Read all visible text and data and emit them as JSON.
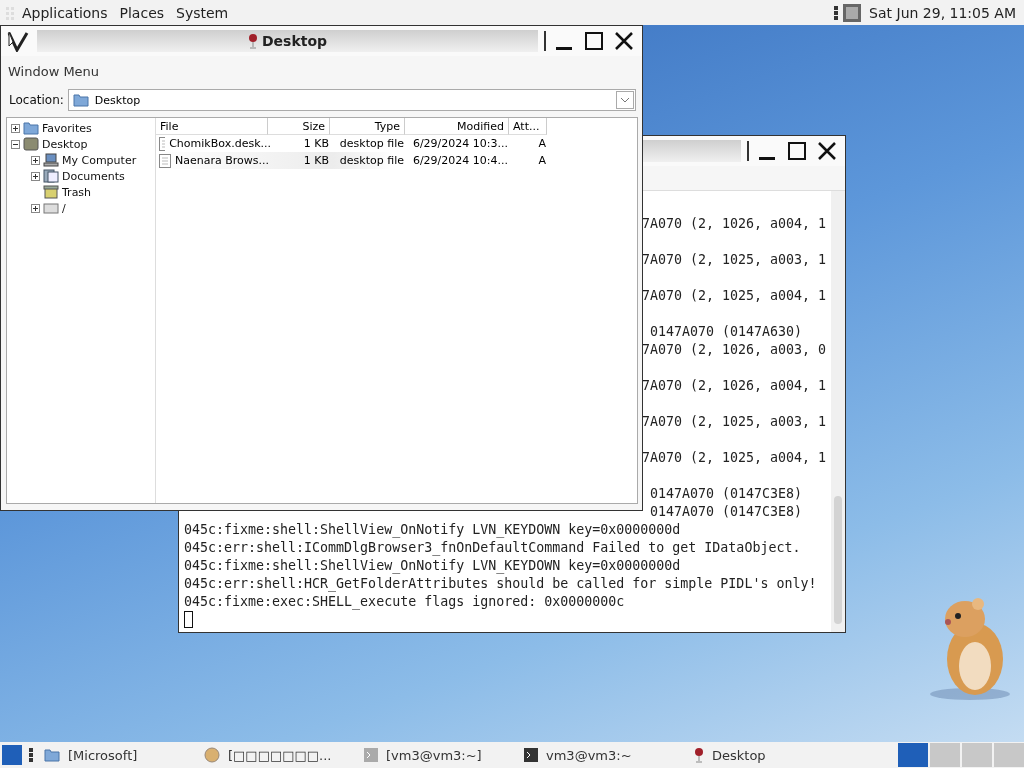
{
  "top_panel": {
    "menus": [
      "Applications",
      "Places",
      "System"
    ],
    "clock": "Sat Jun 29, 11:05 AM"
  },
  "terminal": {
    "lines": [
      {
        "kind": "blank"
      },
      {
        "kind": "tail",
        "text": "7A070 (2, 1026, a004, 1"
      },
      {
        "kind": "blank"
      },
      {
        "kind": "tail",
        "text": "7A070 (2, 1025, a003, 1"
      },
      {
        "kind": "blank"
      },
      {
        "kind": "tail",
        "text": "7A070 (2, 1025, a004, 1"
      },
      {
        "kind": "blank"
      },
      {
        "kind": "tail_far",
        "text": "0147A070 (0147A630)"
      },
      {
        "kind": "tail",
        "text": "7A070 (2, 1026, a003, 0"
      },
      {
        "kind": "blank"
      },
      {
        "kind": "tail",
        "text": "7A070 (2, 1026, a004, 1"
      },
      {
        "kind": "blank"
      },
      {
        "kind": "tail",
        "text": "7A070 (2, 1025, a003, 1"
      },
      {
        "kind": "blank"
      },
      {
        "kind": "tail",
        "text": "7A070 (2, 1025, a004, 1"
      },
      {
        "kind": "blank"
      },
      {
        "kind": "tail_far",
        "text": "0147A070 (0147C3E8)"
      },
      {
        "kind": "tail_far",
        "text": "0147A070 (0147C3E8)"
      },
      {
        "kind": "full",
        "text": "045c:fixme:shell:ShellView_OnNotify LVN_KEYDOWN key=0x0000000d"
      },
      {
        "kind": "full",
        "text": "045c:err:shell:ICommDlgBrowser3_fnOnDefaultCommand Failed to get IDataObject."
      },
      {
        "kind": "full",
        "text": "045c:fixme:shell:ShellView_OnNotify LVN_KEYDOWN key=0x0000000d"
      },
      {
        "kind": "full",
        "text": "045c:err:shell:HCR_GetFolderAttributes should be called for simple PIDL's only!"
      },
      {
        "kind": "full",
        "text": "045c:fixme:exec:SHELL_execute flags ignored: 0x0000000c"
      },
      {
        "kind": "cursor"
      }
    ]
  },
  "explorer": {
    "title": "Desktop",
    "menu": "Window Menu",
    "location_label": "Location:",
    "location": "Desktop",
    "tree": [
      {
        "label": "Favorites",
        "kind": "star",
        "expanded": false
      },
      {
        "label": "Desktop",
        "kind": "desktop",
        "expanded": true,
        "children": [
          {
            "label": "My Computer",
            "kind": "computer",
            "expanded": false
          },
          {
            "label": "Documents",
            "kind": "documents",
            "expanded": false
          },
          {
            "label": "Trash",
            "kind": "trash"
          },
          {
            "label": "/",
            "kind": "drive",
            "expanded": false
          }
        ]
      }
    ],
    "columns": [
      "File",
      "Size",
      "Type",
      "Modified",
      "Att..."
    ],
    "rows": [
      {
        "cells": [
          "ChomikBox.desk...",
          "1 KB",
          "desktop file",
          "6/29/2024 10:3...",
          "A"
        ],
        "selected": false
      },
      {
        "cells": [
          "Naenara Brows...",
          "1 KB",
          "desktop file",
          "6/29/2024 10:4...",
          "A"
        ],
        "selected": true
      }
    ]
  },
  "taskbar": {
    "items": [
      {
        "label": "[Microsoft]",
        "kind": "folder"
      },
      {
        "label": "[□□□□□□□...",
        "kind": "globe"
      },
      {
        "label": "[vm3@vm3:~]",
        "kind": "terminal-gray"
      },
      {
        "label": "vm3@vm3:~",
        "kind": "terminal"
      },
      {
        "label": "Desktop",
        "kind": "wine"
      }
    ],
    "workspaces": [
      {
        "selected": true
      },
      {
        "selected": false
      },
      {
        "selected": false
      },
      {
        "selected": false
      }
    ]
  }
}
